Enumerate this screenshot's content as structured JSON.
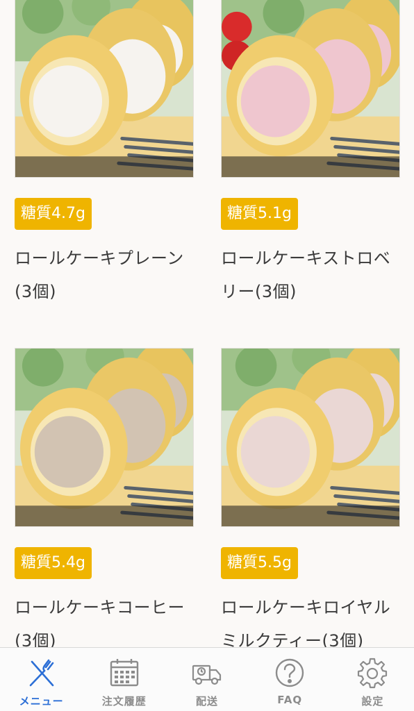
{
  "products": [
    {
      "badge": "糖質4.7g",
      "title": "ロールケーキプレーン(3個)",
      "cream": "#f6f3ef"
    },
    {
      "badge": "糖質5.1g",
      "title": "ロールケーキストロベリー(3個)",
      "cream": "#efc6cf"
    },
    {
      "badge": "糖質5.4g",
      "title": "ロールケーキコーヒー(3個)",
      "cream": "#d2c3b2"
    },
    {
      "badge": "糖質5.5g",
      "title": "ロールケーキロイヤルミルクティー(3個)",
      "cream": "#ead7d4"
    }
  ],
  "tabbar": {
    "items": [
      {
        "label": "メニュー",
        "icon": "fork-knife-icon",
        "active": true
      },
      {
        "label": "注文履歴",
        "icon": "calendar-icon",
        "active": false
      },
      {
        "label": "配送",
        "icon": "delivery-truck-icon",
        "active": false
      },
      {
        "label": "FAQ",
        "icon": "question-icon",
        "active": false
      },
      {
        "label": "設定",
        "icon": "gear-icon",
        "active": false
      }
    ]
  },
  "colors": {
    "badge": "#efb400",
    "active_tab": "#2c6fd6",
    "inactive_tab": "#8c8c8c"
  }
}
